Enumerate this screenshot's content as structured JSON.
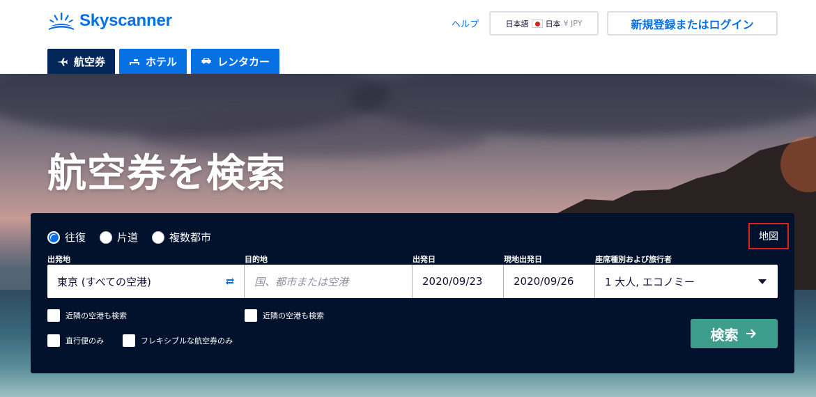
{
  "brand": {
    "name": "Skyscanner",
    "color": "#0770e3"
  },
  "header": {
    "help": "ヘルプ",
    "locale": {
      "language": "日本語",
      "country": "日本",
      "currency": "¥ JPY"
    },
    "login": "新規登録またはログイン"
  },
  "tabs": [
    {
      "label": "航空券",
      "icon": "plane-icon",
      "active": true
    },
    {
      "label": "ホテル",
      "icon": "bed-icon",
      "active": false
    },
    {
      "label": "レンタカー",
      "icon": "car-icon",
      "active": false
    }
  ],
  "hero": {
    "title": "航空券を検索"
  },
  "search": {
    "trip_types": [
      {
        "label": "往復",
        "checked": true
      },
      {
        "label": "片道",
        "checked": false
      },
      {
        "label": "複数都市",
        "checked": false
      }
    ],
    "map_label": "地図",
    "fields": {
      "origin": {
        "label": "出発地",
        "value": "東京 (すべての空港)"
      },
      "destination": {
        "label": "目的地",
        "placeholder": "国、都市または空港"
      },
      "depart": {
        "label": "出発日",
        "value": "2020/09/23"
      },
      "return": {
        "label": "現地出発日",
        "value": "2020/09/26"
      },
      "cabin": {
        "label": "座席種別および旅行者",
        "value": "1 大人, エコノミー"
      }
    },
    "checkboxes": {
      "nearby_origin": "近隣の空港も検索",
      "nearby_destination": "近隣の空港も検索",
      "direct_only": "直行便のみ",
      "flexible": "フレキシブルな航空券のみ"
    },
    "submit": "検索"
  },
  "colors": {
    "panel": "#02122c",
    "search_button": "#3d9e8d",
    "active_tab": "#042759"
  }
}
